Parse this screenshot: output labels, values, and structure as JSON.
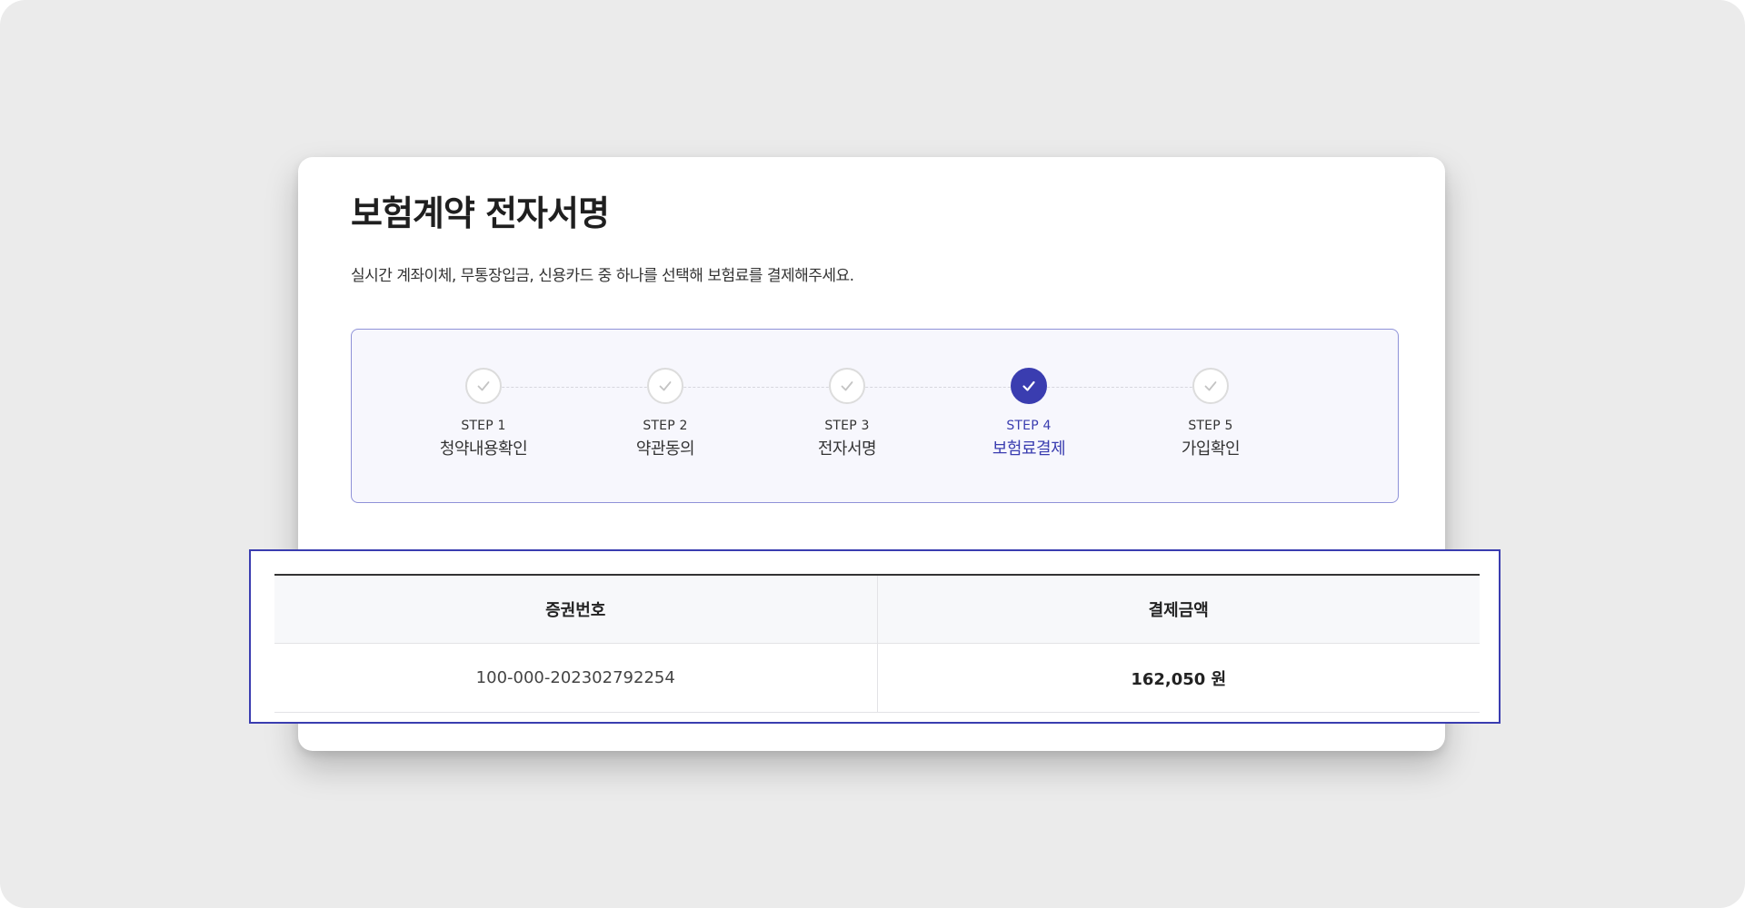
{
  "page": {
    "title": "보험계약 전자서명",
    "description": "실시간 계좌이체, 무통장입금, 신용카드 중 하나를 선택해 보험료를 결제해주세요."
  },
  "stepper": {
    "current_step": 4,
    "steps": [
      {
        "number": "STEP 1",
        "label": "청약내용확인",
        "icon": "check-icon",
        "active": false
      },
      {
        "number": "STEP 2",
        "label": "약관동의",
        "icon": "check-icon",
        "active": false
      },
      {
        "number": "STEP 3",
        "label": "전자서명",
        "icon": "check-icon",
        "active": false
      },
      {
        "number": "STEP 4",
        "label": "보험료결제",
        "icon": "check-icon",
        "active": true
      },
      {
        "number": "STEP 5",
        "label": "가입확인",
        "icon": "check-icon",
        "active": false
      }
    ]
  },
  "payment_table": {
    "headers": [
      "증권번호",
      "결제금액"
    ],
    "rows": [
      [
        "100-000-202302792254",
        "162,050 원"
      ]
    ]
  },
  "colors": {
    "accent": "#3a3db0",
    "stepper_border": "#8f92d8",
    "stepper_background": "#f7f7fd",
    "inactive_circle_border": "#dcdcdc",
    "inactive_check": "#c4c4c4",
    "backdrop": "#ebebeb",
    "table_header_background": "#f7f8fa"
  }
}
